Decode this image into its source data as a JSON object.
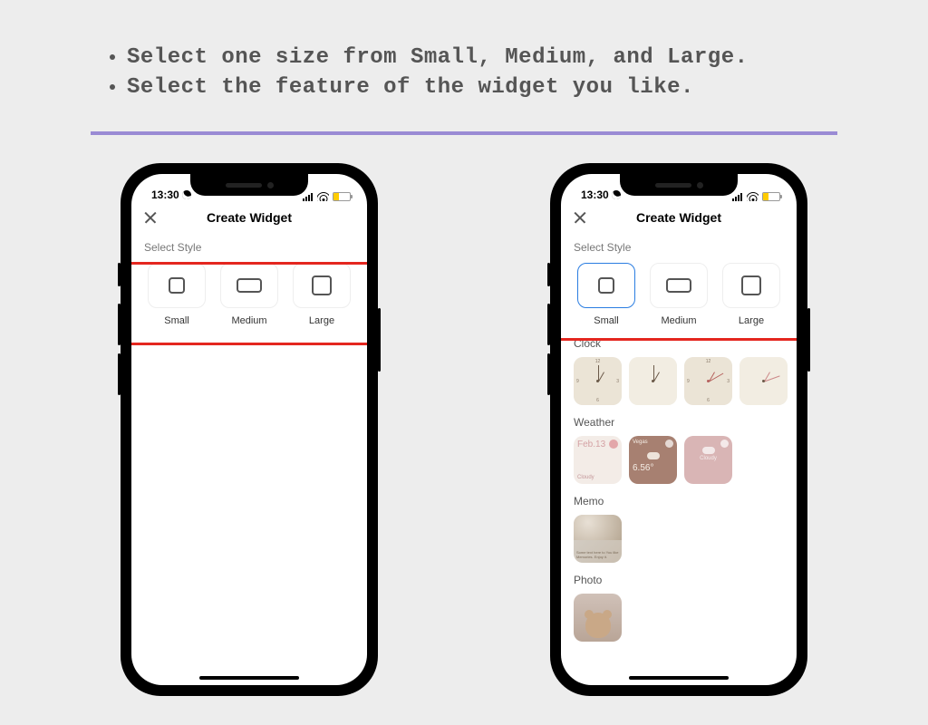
{
  "instructions": [
    "Select one size from Small, Medium, and Large.",
    "Select the feature of the widget you like."
  ],
  "status": {
    "time": "13:30"
  },
  "header": {
    "title": "Create Widget"
  },
  "selectStyle": {
    "label": "Select Style",
    "sizes": [
      {
        "id": "small",
        "label": "Small"
      },
      {
        "id": "medium",
        "label": "Medium"
      },
      {
        "id": "large",
        "label": "Large"
      }
    ],
    "selectedRight": "small"
  },
  "categories": {
    "clock": {
      "label": "Clock"
    },
    "weather": {
      "label": "Weather",
      "tile1": {
        "date": "Feb.13",
        "cond": "Cloudy"
      },
      "tile2": {
        "city": "Vegas",
        "temp": "6.56°",
        "cond": "Cloudy"
      },
      "tile3": {
        "cond": "Cloudy"
      }
    },
    "memo": {
      "label": "Memo",
      "text": "Some text here to You like Memories. Enjoy it."
    },
    "photo": {
      "label": "Photo"
    }
  }
}
